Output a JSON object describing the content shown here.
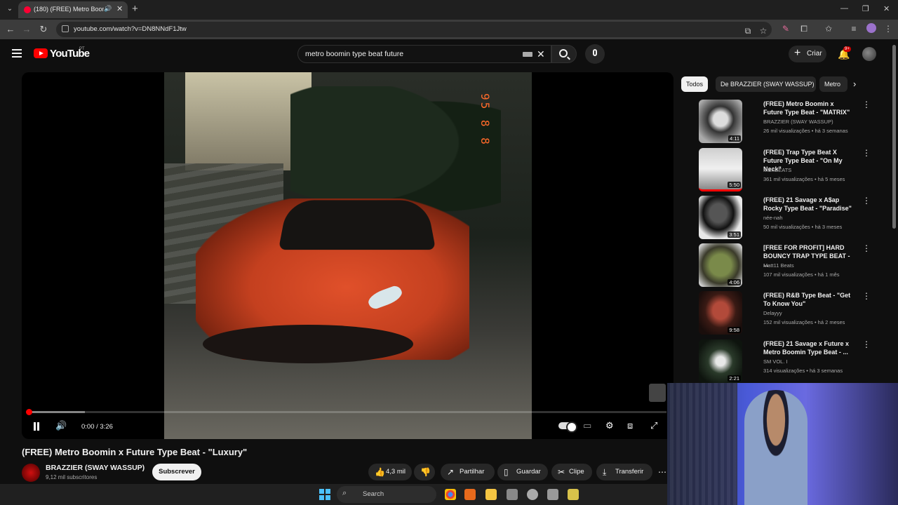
{
  "browser": {
    "tab_title": "(180) (FREE) Metro Boomin",
    "url": "youtube.com/watch?v=DN8NNdF1Jtw"
  },
  "header": {
    "logo": "YouTube",
    "country": "PT",
    "search_query": "metro boomin type beat future",
    "create_label": "Criar",
    "notif_badge": "9+"
  },
  "player": {
    "time": "0:00 / 3:26",
    "progress_fraction": 0.0,
    "buffer_fraction": 0.088,
    "date_stamp": "95 8 8"
  },
  "video": {
    "title": "(FREE) Metro Boomin x Future Type Beat - \"Luxury\"",
    "channel": "BRAZZIER (SWAY WASSUP)",
    "subscribers": "9,12 mil subscritores",
    "subscribe_label": "Subscrever",
    "likes": "4,3 mil",
    "share": "Partilhar",
    "save": "Guardar",
    "clip": "Clipe",
    "download": "Transferir"
  },
  "sidebar": {
    "chips": [
      "Todos",
      "De BRAZZIER (SWAY WASSUP)",
      "Metro"
    ],
    "items": [
      {
        "title": "(FREE) Metro Boomin x Future Type Beat - \"MATRIX\"",
        "channel": "BRAZZIER (SWAY WASSUP)",
        "meta": "26 mil visualizações • há 3 semanas",
        "duration": "4:11"
      },
      {
        "title": "(FREE) Trap Type Beat X Future Type Beat - \"On My Neck\"",
        "channel": "MSKBEATS",
        "meta": "361 mil visualizações • há 5 meses",
        "duration": "5:50"
      },
      {
        "title": "(FREE) 21 Savage x A$ap Rocky Type Beat - \"Paradise\"",
        "channel": "née-nah",
        "meta": "50 mil visualizações • há 3 meses",
        "duration": "3:51"
      },
      {
        "title": "[FREE FOR PROFIT] HARD BOUNCY TRAP TYPE BEAT - ...",
        "channel": "Matt11 Beats",
        "meta": "107 mil visualizações • há 1 mês",
        "duration": "4:06"
      },
      {
        "title": "(FREE) R&B Type Beat - \"Get To Know You\"",
        "channel": "Delayyy",
        "meta": "152 mil visualizações • há 2 meses",
        "duration": "9:58"
      },
      {
        "title": "(FREE) 21 Savage x Future x Metro Boomin Type Beat - ...",
        "channel": "SM VOL. I",
        "meta": "314 visualizações • há 3 semanas",
        "duration": "2:21"
      }
    ]
  },
  "taskbar": {
    "search": "Search"
  }
}
